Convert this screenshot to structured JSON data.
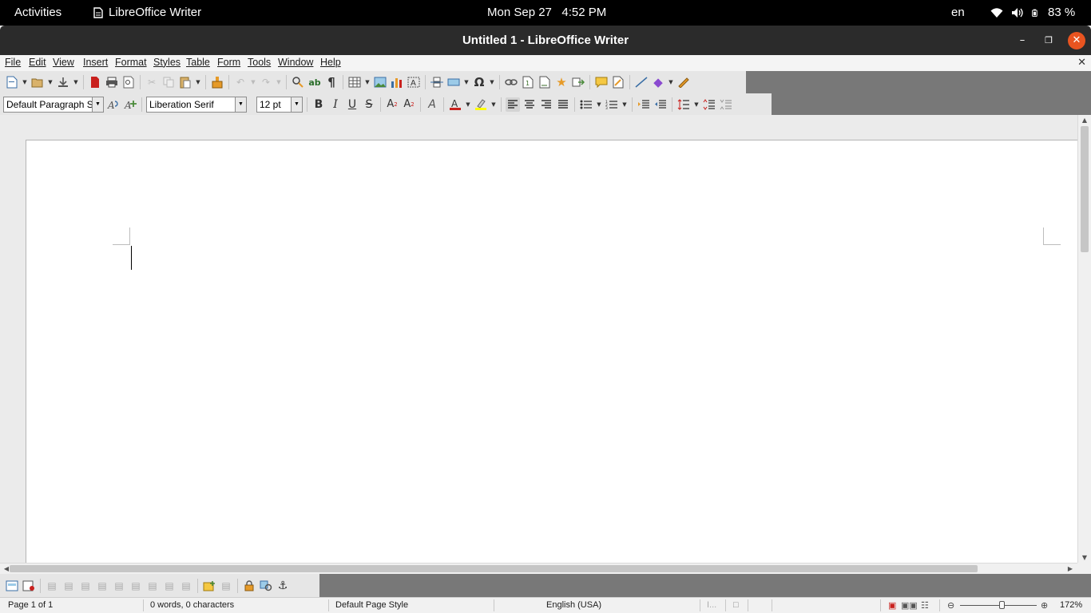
{
  "topbar": {
    "activities": "Activities",
    "app_name": "LibreOffice Writer",
    "clock": "Mon Sep 27   4:52 PM",
    "language": "en",
    "battery": "83 %"
  },
  "window": {
    "title": "Untitled 1 - LibreOffice Writer"
  },
  "menubar": {
    "items": [
      "File",
      "Edit",
      "View",
      "Insert",
      "Format",
      "Styles",
      "Table",
      "Form",
      "Tools",
      "Window",
      "Help"
    ]
  },
  "format_toolbar": {
    "paragraph_style": "Default Paragraph Sty",
    "font_name": "Liberation Serif",
    "font_size": "12 pt"
  },
  "statusbar": {
    "page": "Page 1 of 1",
    "word_count": "0 words, 0 characters",
    "page_style": "Default Page Style",
    "language": "English (USA)",
    "zoom": "172%"
  },
  "colors": {
    "accent_close": "#e95420",
    "font_color": "#c9211e",
    "highlight_color": "#ffff00"
  }
}
